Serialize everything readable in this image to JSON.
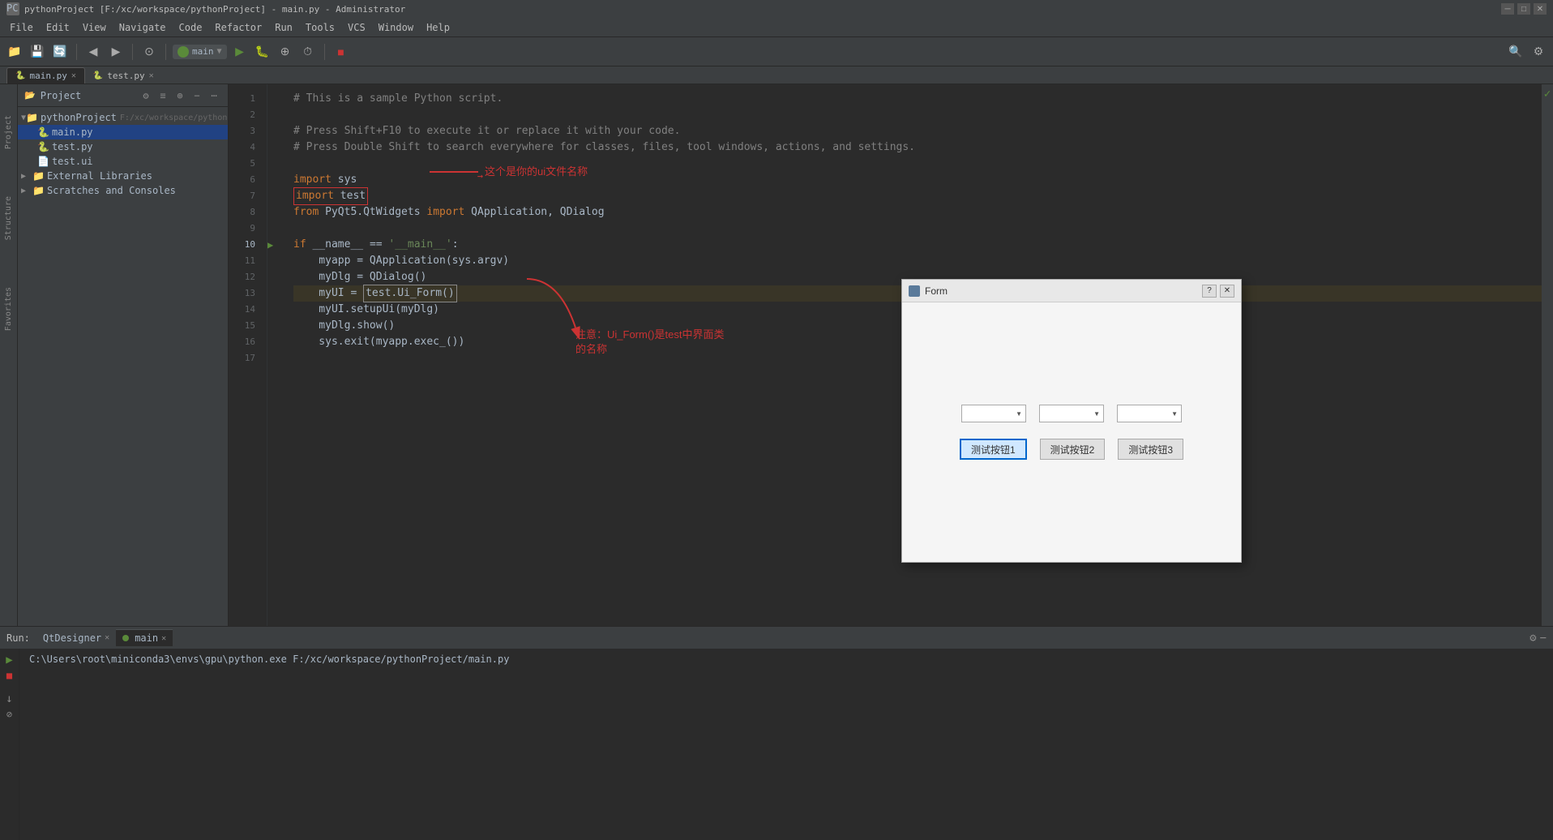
{
  "window": {
    "title": "pythonProject [F:/xc/workspace/pythonProject] - main.py - Administrator",
    "icon": "PC"
  },
  "titlebar": {
    "title": "pythonProject [F:/xc/workspace/pythonProject] - main.py - Administrator",
    "minimize": "─",
    "maximize": "□",
    "close": "✕"
  },
  "menubar": {
    "items": [
      "File",
      "Edit",
      "View",
      "Navigate",
      "Code",
      "Refactor",
      "Run",
      "Tools",
      "VCS",
      "Window",
      "Help"
    ]
  },
  "toolbar": {
    "run_config": "main",
    "buttons": [
      "project_icon",
      "save_all",
      "sync",
      "back",
      "forward",
      "git_btn",
      "main_config",
      "run_green",
      "run_debug",
      "coverage",
      "run_profile",
      "stop_red"
    ]
  },
  "top_tabs": [
    {
      "label": "main.py",
      "active": true,
      "closable": true,
      "icon": "py"
    },
    {
      "label": "test.py",
      "active": false,
      "closable": true,
      "icon": "py"
    }
  ],
  "sidebar": {
    "header": "Project",
    "path_label": "F:/xc/workspace/pythonPro",
    "tree": [
      {
        "label": "pythonProject",
        "path": "F:/xc/workspace/pythonPro",
        "type": "folder",
        "expanded": true,
        "level": 0
      },
      {
        "label": "main.py",
        "type": "file_py",
        "level": 1,
        "selected": true
      },
      {
        "label": "test.py",
        "type": "file_py",
        "level": 1,
        "selected": false
      },
      {
        "label": "test.ui",
        "type": "file_ui",
        "level": 1,
        "selected": false
      },
      {
        "label": "External Libraries",
        "type": "folder",
        "level": 0,
        "expanded": false
      },
      {
        "label": "Scratches and Consoles",
        "type": "folder",
        "level": 0,
        "expanded": false
      }
    ]
  },
  "code": {
    "lines": [
      {
        "num": 1,
        "text": "# This is a sample Python script.",
        "type": "comment"
      },
      {
        "num": 2,
        "text": "",
        "type": "empty"
      },
      {
        "num": 3,
        "text": "# Press Shift+F10 to execute it or replace it with your code.",
        "type": "comment"
      },
      {
        "num": 4,
        "text": "# Press Double Shift to search everywhere for classes, files, tool windows, actions, and settings.",
        "type": "comment"
      },
      {
        "num": 5,
        "text": "",
        "type": "empty"
      },
      {
        "num": 6,
        "text": "import sys",
        "type": "import"
      },
      {
        "num": 7,
        "text": "import test",
        "type": "import_highlighted"
      },
      {
        "num": 8,
        "text": "from PyQt5.QtWidgets import QApplication, QDialog",
        "type": "import"
      },
      {
        "num": 9,
        "text": "",
        "type": "empty"
      },
      {
        "num": 10,
        "text": "if __name__ == '__main__':",
        "type": "code",
        "has_run": true
      },
      {
        "num": 11,
        "text": "    myapp = QApplication(sys.argv)",
        "type": "code"
      },
      {
        "num": 12,
        "text": "    myDlg = QDialog()",
        "type": "code"
      },
      {
        "num": 13,
        "text": "    myUI = test.Ui_Form()",
        "type": "code_highlighted"
      },
      {
        "num": 14,
        "text": "    myUI.setupUi(myDlg)",
        "type": "code"
      },
      {
        "num": 15,
        "text": "    myDlg.show()",
        "type": "code"
      },
      {
        "num": 16,
        "text": "    sys.exit(myapp.exec_())",
        "type": "code"
      },
      {
        "num": 17,
        "text": "",
        "type": "empty"
      }
    ]
  },
  "annotations": {
    "arrow1_text": "这个是你的ui文件名称",
    "arrow2_text": "注意：Ui_Form()是test中界面类\n的名称"
  },
  "qt_dialog": {
    "title": "Form",
    "help_btn": "?",
    "close_btn": "✕",
    "dropdowns": [
      "",
      "",
      ""
    ],
    "buttons": [
      "测试按钮1",
      "测试按钮2",
      "测试按钮3"
    ]
  },
  "bottom": {
    "run_label": "Run:",
    "tabs": [
      {
        "label": "QtDesigner",
        "closable": true
      },
      {
        "label": "main",
        "closable": true,
        "active": true
      }
    ],
    "terminal_text": "C:\\Users\\root\\miniconda3\\envs\\gpu\\python.exe F:/xc/workspace/pythonProject/main.py"
  },
  "side_labels": [
    "Structure",
    "Project",
    "Favorites"
  ]
}
